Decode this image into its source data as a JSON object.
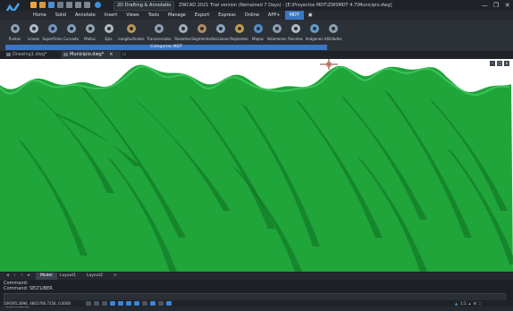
{
  "app": {
    "workspace": "2D Drafting & Annotatio",
    "window_title": "ZWCAD 2021 Trial version (Remained 7 Days) - [E:\\Proyectos MDT\\ZWSMDT 4.7\\Municipio.dwg]"
  },
  "menu": [
    "Home",
    "Solid",
    "Annotate",
    "Insert",
    "Views",
    "Tools",
    "Manage",
    "Export",
    "Express",
    "Online",
    "APP+",
    "MDT"
  ],
  "menu_active": "MDT",
  "ribbon": {
    "tools": [
      "Puntos",
      "Líneas",
      "Superficies",
      "Curvado",
      "Mallas",
      "Ejes",
      "Longitudinales",
      "Transversales",
      "Rasantes",
      "Segmentos",
      "Secciones",
      "Replanteo",
      "Mapas",
      "Volúmenes",
      "Parcelas",
      "Imágenes",
      "Utilidades"
    ],
    "group_label": "Categorías MDT"
  },
  "doc_tabs": [
    {
      "label": "Drawing1.dwg*",
      "active": false
    },
    {
      "label": "Municipio.dwg*",
      "active": true
    }
  ],
  "viewport": {
    "background": "#ffffff",
    "terrain_color": "#1fa53a",
    "terrain_dark": "#0f6d22"
  },
  "layout_tabs": [
    "Model",
    "Layout1",
    "Layout2",
    "+"
  ],
  "layout_active": "Model",
  "command": {
    "lines": [
      "Command:",
      "Command: SELTLIBER"
    ],
    "prompt": "Command:"
  },
  "status": {
    "coords": "509395.2896, 4801706.7356, 0.0000",
    "scale": "1:1"
  }
}
